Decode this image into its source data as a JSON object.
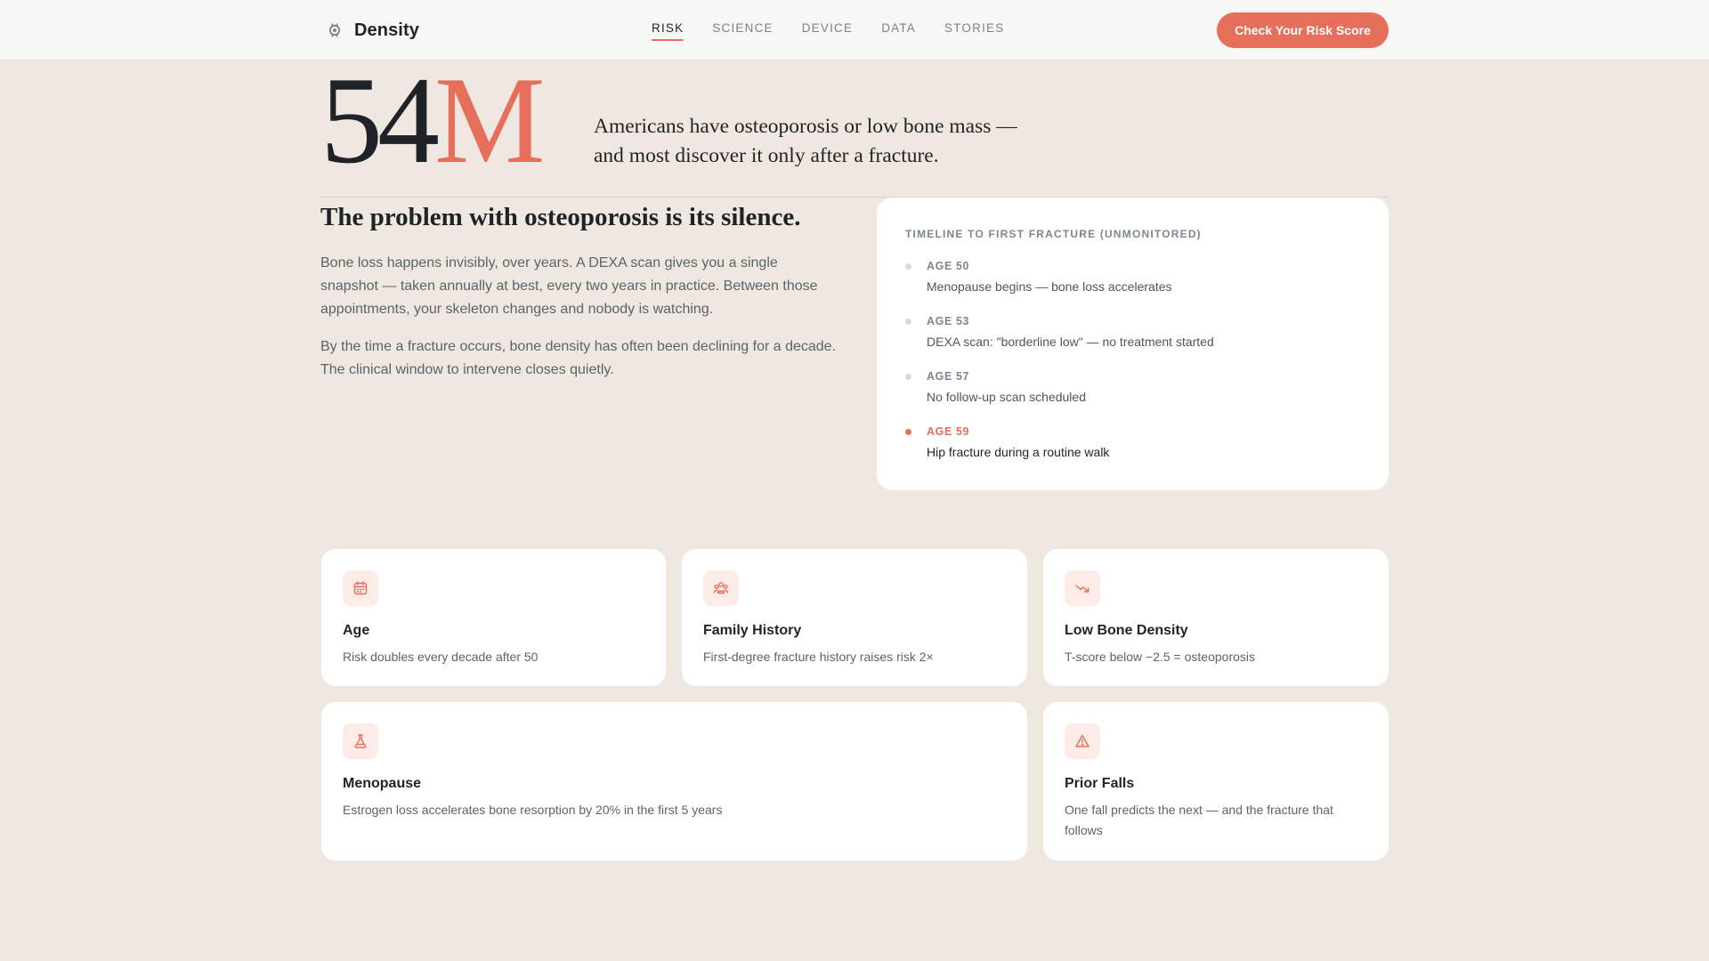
{
  "header": {
    "brand": "Density",
    "nav": [
      {
        "label": "RISK",
        "active": true
      },
      {
        "label": "SCIENCE",
        "active": false
      },
      {
        "label": "DEVICE",
        "active": false
      },
      {
        "label": "DATA",
        "active": false
      },
      {
        "label": "STORIES",
        "active": false
      }
    ],
    "cta_label": "Check Your Risk Score"
  },
  "hero": {
    "stat_number": "54",
    "stat_unit": "M",
    "line1": "Americans have osteoporosis or low bone mass —",
    "line2": "and most discover it only after a fracture."
  },
  "problem": {
    "title": "The problem with osteoporosis is its silence.",
    "p1": "Bone loss happens invisibly, over years. A DEXA scan gives you a single snapshot — taken annually at best, every two years in practice. Between those appointments, your skeleton changes and nobody is watching.",
    "p2": "By the time a fracture occurs, bone density has often been declining for a decade. The clinical window to intervene closes quietly."
  },
  "timeline": {
    "title": "TIMELINE TO FIRST FRACTURE (UNMONITORED)",
    "items": [
      {
        "age": "AGE 50",
        "desc": "Menopause begins — bone loss accelerates",
        "highlight": false
      },
      {
        "age": "AGE 53",
        "desc": "DEXA scan: \"borderline low\" — no treatment started",
        "highlight": false
      },
      {
        "age": "AGE 57",
        "desc": "No follow-up scan scheduled",
        "highlight": false
      },
      {
        "age": "AGE 59",
        "desc": "Hip fracture during a routine walk",
        "highlight": true
      }
    ]
  },
  "factors": [
    {
      "icon": "calendar-icon",
      "title": "Age",
      "desc": "Risk doubles every decade after 50"
    },
    {
      "icon": "family-icon",
      "title": "Family History",
      "desc": "First-degree fracture history raises risk 2×"
    },
    {
      "icon": "trend-down-icon",
      "title": "Low Bone Density",
      "desc": "T-score below −2.5 = osteoporosis"
    },
    {
      "icon": "flask-icon",
      "title": "Menopause",
      "desc": "Estrogen loss accelerates bone resorption by 20% in the first 5 years"
    },
    {
      "icon": "warning-icon",
      "title": "Prior Falls",
      "desc": "One fall predicts the next — and the fracture that follows"
    }
  ],
  "colors": {
    "accent": "#e56f5b",
    "background": "#efe8e0",
    "card": "#ffffff",
    "icon_bg": "#fcebe7"
  }
}
